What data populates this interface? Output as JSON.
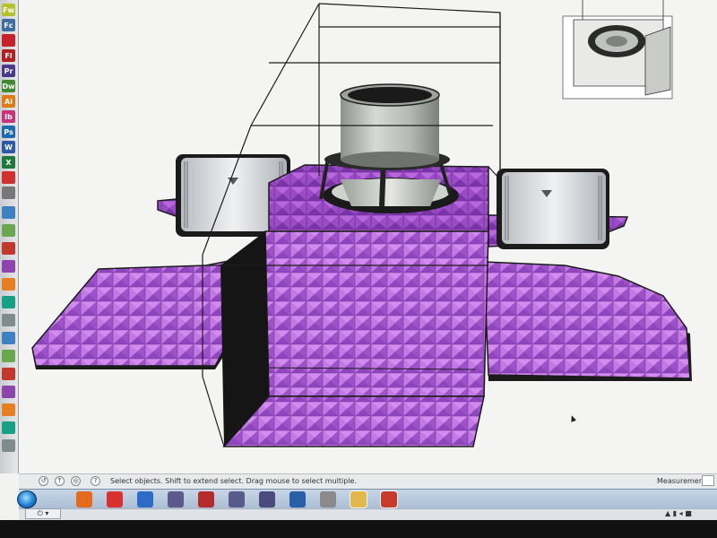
{
  "app": {
    "status_text": "Select objects. Shift to extend select. Drag mouse to select multiple.",
    "measurements_label": "Measurements",
    "status_buttons": [
      "↺",
      "↑",
      "◎",
      "?"
    ]
  },
  "dock": {
    "icons": [
      {
        "label": "Fw",
        "color": "#b5c22a"
      },
      {
        "label": "Fc",
        "color": "#3d6da3"
      },
      {
        "label": "",
        "color": "#c6202a"
      },
      {
        "label": "Fl",
        "color": "#b0201f"
      },
      {
        "label": "Pr",
        "color": "#4a3a8c"
      },
      {
        "label": "Dw",
        "color": "#3f8a30"
      },
      {
        "label": "Ai",
        "color": "#e07b14"
      },
      {
        "label": "Ib",
        "color": "#c8337b"
      },
      {
        "label": "Ps",
        "color": "#1c6ab0"
      },
      {
        "label": "W",
        "color": "#2c5aa9"
      },
      {
        "label": "X",
        "color": "#1e7a3c"
      },
      {
        "label": "",
        "color": "#d03030"
      },
      {
        "label": "",
        "color": "#777777"
      }
    ]
  },
  "taskbar": {
    "icons": [
      {
        "name": "firefox-icon",
        "color": "#e66a1d"
      },
      {
        "name": "car-app-icon",
        "color": "#d93030"
      },
      {
        "name": "app-o-icon",
        "color": "#2d6cc6"
      },
      {
        "name": "adobe-tool-icon",
        "color": "#5a5a8c"
      },
      {
        "name": "adobe-tool-2-icon",
        "color": "#b52a2a"
      },
      {
        "name": "adobe-tool-3-icon",
        "color": "#5a5a8c"
      },
      {
        "name": "adobe-tool-4-icon",
        "color": "#4a4a7c"
      },
      {
        "name": "airplane-app-icon",
        "color": "#2a5fa8"
      },
      {
        "name": "disc-icon",
        "color": "#8a8a8a"
      },
      {
        "name": "folder-icon",
        "color": "#e2b84b"
      },
      {
        "name": "sketchup-icon",
        "color": "#c73b2c"
      }
    ]
  },
  "colors": {
    "pad_top": "#c87adf",
    "pad_mid": "#a95bd0",
    "edge": "#1a1a1a",
    "speaker": "#c8ccc6",
    "amp": "#d9dbde"
  }
}
